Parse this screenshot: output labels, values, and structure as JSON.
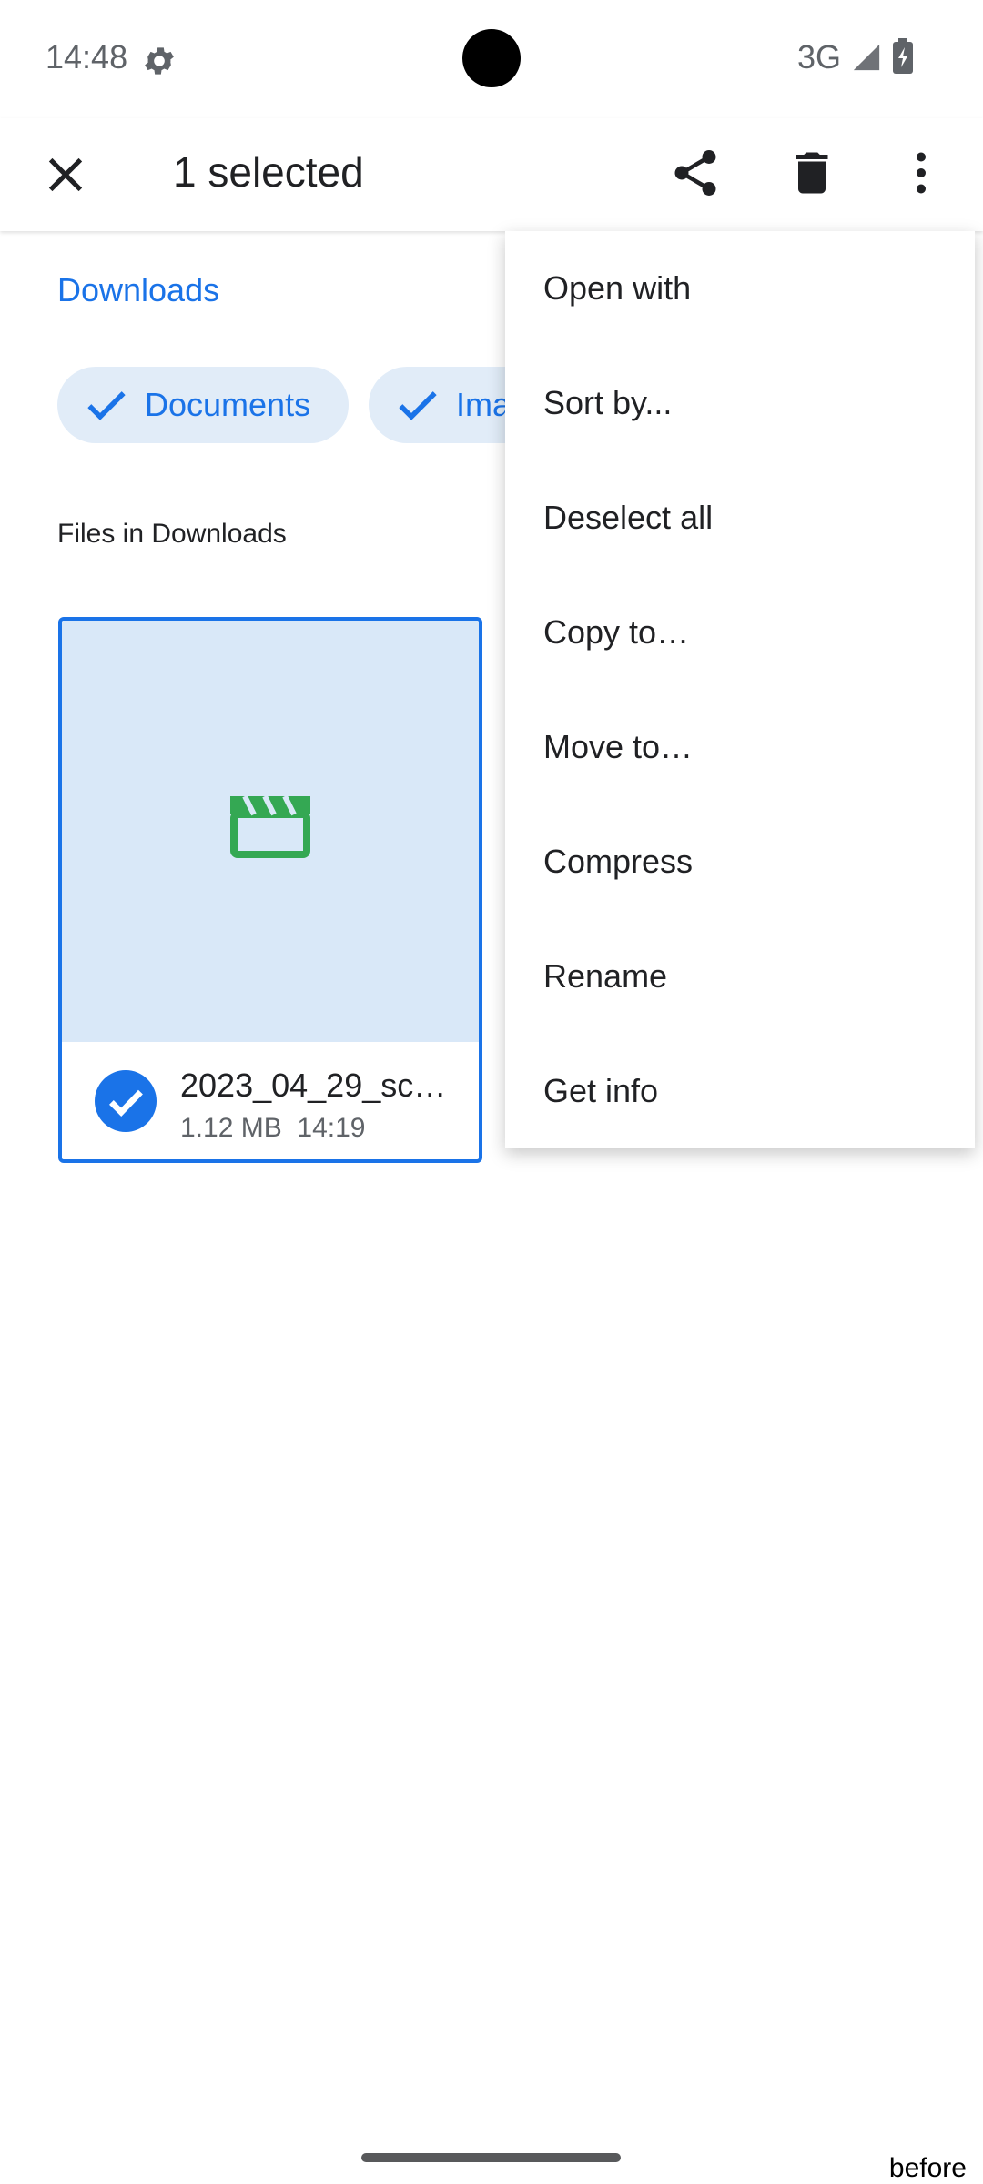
{
  "status_bar": {
    "time": "14:48",
    "network": "3G",
    "icons": [
      "gear-icon",
      "signal-icon",
      "battery-charging-icon"
    ]
  },
  "app_bar": {
    "title": "1 selected",
    "icons": [
      "close-icon",
      "share-icon",
      "delete-icon",
      "more-vert-icon"
    ]
  },
  "breadcrumb": "Downloads",
  "chips": [
    {
      "label": "Documents",
      "selected": true
    },
    {
      "label": "Ima",
      "selected": true
    }
  ],
  "section_title": "Files in Downloads",
  "file": {
    "name": "2023_04_29_sc…",
    "size": "1.12 MB",
    "time": "14:19",
    "selected": true,
    "icon": "video-clapper-icon"
  },
  "menu": {
    "items": [
      {
        "label": "Open with"
      },
      {
        "label": "Sort by..."
      },
      {
        "label": "Deselect all"
      },
      {
        "label": "Copy to…"
      },
      {
        "label": "Move to…"
      },
      {
        "label": "Compress"
      },
      {
        "label": "Rename"
      },
      {
        "label": "Get info"
      }
    ]
  },
  "corner_note": "before",
  "colors": {
    "accent": "#1a73e8",
    "chip_bg": "#e1ecf8",
    "thumb_bg": "#d9e8f8",
    "video_icon": "#34a853"
  }
}
